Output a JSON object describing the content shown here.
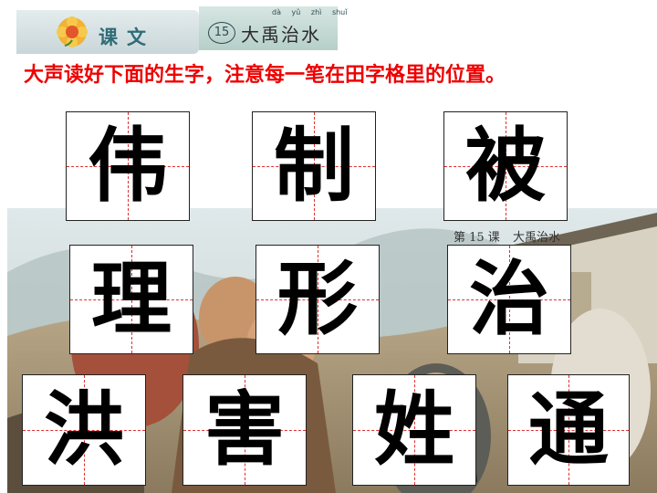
{
  "header": {
    "lesson_label": "课文",
    "lesson_number": "15",
    "lesson_title": "大禹治水",
    "pinyin": [
      "dà",
      "yǔ",
      "zhì",
      "shuǐ"
    ],
    "flower_icon": "flower-icon"
  },
  "instruction": "大声读好下面的生字，注意每一笔在田字格里的位置。",
  "background": {
    "caption_lesson": "第 15 课",
    "caption_title": "大禹治水"
  },
  "characters": {
    "row1": [
      "伟",
      "制",
      "被"
    ],
    "row2": [
      "理",
      "形",
      "治"
    ],
    "row3": [
      "洪",
      "害",
      "姓",
      "通"
    ]
  },
  "colors": {
    "instruction": "#ee0000",
    "grid_guide": "#e03030",
    "grid_border": "#222222"
  }
}
